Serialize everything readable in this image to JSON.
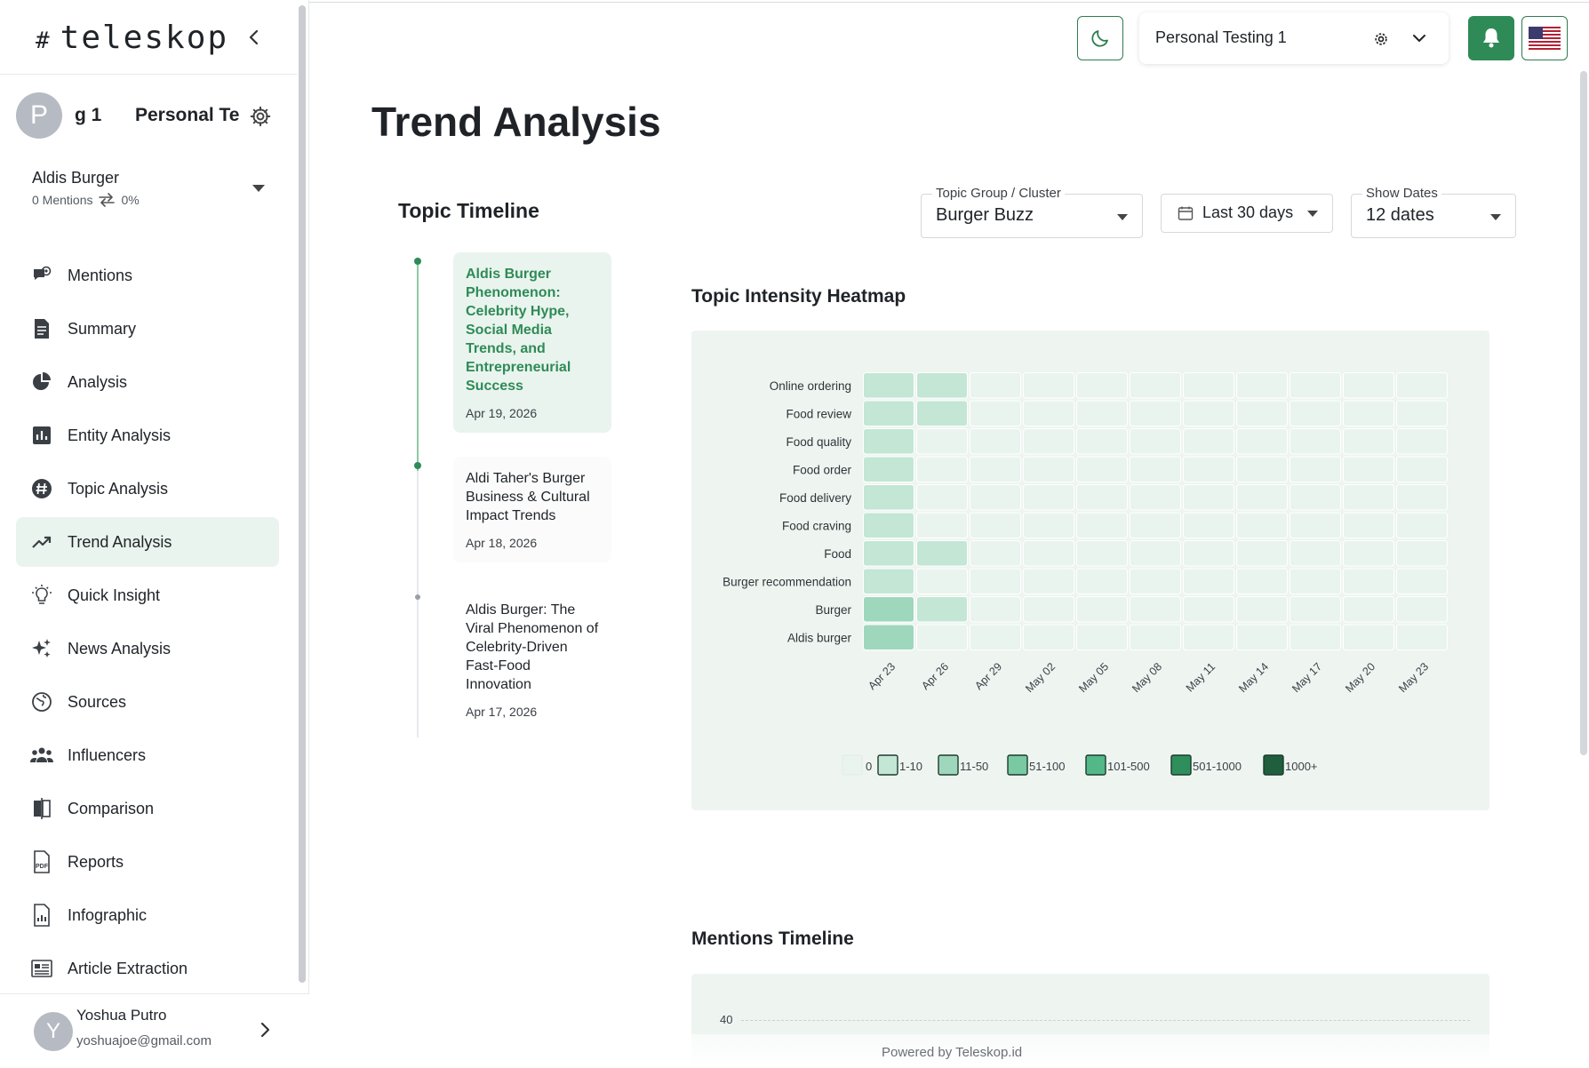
{
  "app": {
    "logo_text": "teleskop",
    "logo_hash": "#"
  },
  "workspace": {
    "avatar_letter": "P",
    "name": "g 1",
    "team": "Personal Te"
  },
  "project": {
    "name": "Aldis Burger",
    "mentions": "0 Mentions",
    "change": "0%"
  },
  "nav": [
    {
      "label": "Mentions",
      "icon": "mentions-icon",
      "active": false
    },
    {
      "label": "Summary",
      "icon": "document-icon",
      "active": false
    },
    {
      "label": "Analysis",
      "icon": "pie-chart-icon",
      "active": false
    },
    {
      "label": "Entity Analysis",
      "icon": "bar-chart-icon",
      "active": false
    },
    {
      "label": "Topic Analysis",
      "icon": "hashtag-icon",
      "active": false
    },
    {
      "label": "Trend Analysis",
      "icon": "trending-up-icon",
      "active": true
    },
    {
      "label": "Quick Insight",
      "icon": "lightbulb-icon",
      "active": false
    },
    {
      "label": "News Analysis",
      "icon": "sparkles-icon",
      "active": false
    },
    {
      "label": "Sources",
      "icon": "globe-icon",
      "active": false
    },
    {
      "label": "Influencers",
      "icon": "people-icon",
      "active": false
    },
    {
      "label": "Comparison",
      "icon": "compare-icon",
      "active": false
    },
    {
      "label": "Reports",
      "icon": "pdf-icon",
      "active": false
    },
    {
      "label": "Infographic",
      "icon": "infographic-icon",
      "active": false
    },
    {
      "label": "Article Extraction",
      "icon": "article-icon",
      "active": false
    }
  ],
  "user": {
    "avatar_letter": "Y",
    "name": "Yoshua Putro",
    "email": "yoshuajoe@gmail.com"
  },
  "header": {
    "workspace_select": "Personal Testing 1"
  },
  "page": {
    "title": "Trend Analysis"
  },
  "timeline": {
    "title": "Topic Timeline",
    "items": [
      {
        "title": "Aldis Burger Phenomenon: Celebrity Hype, Social Media Trends, and Entrepreneurial Success",
        "date": "Apr 19, 2026"
      },
      {
        "title": "Aldi Taher's Burger Business & Cultural Impact Trends",
        "date": "Apr 18, 2026"
      },
      {
        "title": "Aldis Burger: The Viral Phenomenon of Celebrity-Driven Fast-Food Innovation",
        "date": "Apr 17, 2026"
      }
    ]
  },
  "filters": {
    "group": {
      "label": "Topic Group / Cluster",
      "value": "Burger Buzz"
    },
    "range": {
      "value": "Last 30 days"
    },
    "dates": {
      "label": "Show Dates",
      "value": "12 dates"
    }
  },
  "heatmap": {
    "title": "Topic Intensity Heatmap"
  },
  "mentions_timeline": {
    "title": "Mentions Timeline",
    "y_tick": "40"
  },
  "footer": {
    "text": "Powered by Teleskop.id"
  },
  "colors": {
    "accent": "#2e8b57",
    "active_bg": "#eaf4ee",
    "panel_bg": "#eef5f1"
  },
  "chart_data": {
    "type": "heatmap",
    "title": "Topic Intensity Heatmap",
    "rows": [
      "Online ordering",
      "Food review",
      "Food quality",
      "Food order",
      "Food delivery",
      "Food craving",
      "Food",
      "Burger recommendation",
      "Burger",
      "Aldis burger"
    ],
    "columns": [
      "Apr 23",
      "Apr 26",
      "Apr 29",
      "May 02",
      "May 05",
      "May 08",
      "May 11",
      "May 14",
      "May 17",
      "May 20",
      "May 23"
    ],
    "bins": [
      "0",
      "1-10",
      "11-50",
      "51-100",
      "101-500",
      "501-1000",
      "1000+"
    ],
    "bin_colors": [
      "#eaf4ef",
      "#c3e6d5",
      "#9fd7bd",
      "#79c9a2",
      "#52b888",
      "#2f8f5c",
      "#1f5f3e"
    ],
    "values_bin_index": [
      [
        1,
        1,
        0,
        0,
        0,
        0,
        0,
        0,
        0,
        0,
        0
      ],
      [
        1,
        1,
        0,
        0,
        0,
        0,
        0,
        0,
        0,
        0,
        0
      ],
      [
        1,
        0,
        0,
        0,
        0,
        0,
        0,
        0,
        0,
        0,
        0
      ],
      [
        1,
        0,
        0,
        0,
        0,
        0,
        0,
        0,
        0,
        0,
        0
      ],
      [
        1,
        0,
        0,
        0,
        0,
        0,
        0,
        0,
        0,
        0,
        0
      ],
      [
        1,
        0,
        0,
        0,
        0,
        0,
        0,
        0,
        0,
        0,
        0
      ],
      [
        1,
        1,
        0,
        0,
        0,
        0,
        0,
        0,
        0,
        0,
        0
      ],
      [
        1,
        0,
        0,
        0,
        0,
        0,
        0,
        0,
        0,
        0,
        0
      ],
      [
        2,
        1,
        0,
        0,
        0,
        0,
        0,
        0,
        0,
        0,
        0
      ],
      [
        2,
        0,
        0,
        0,
        0,
        0,
        0,
        0,
        0,
        0,
        0
      ]
    ]
  }
}
